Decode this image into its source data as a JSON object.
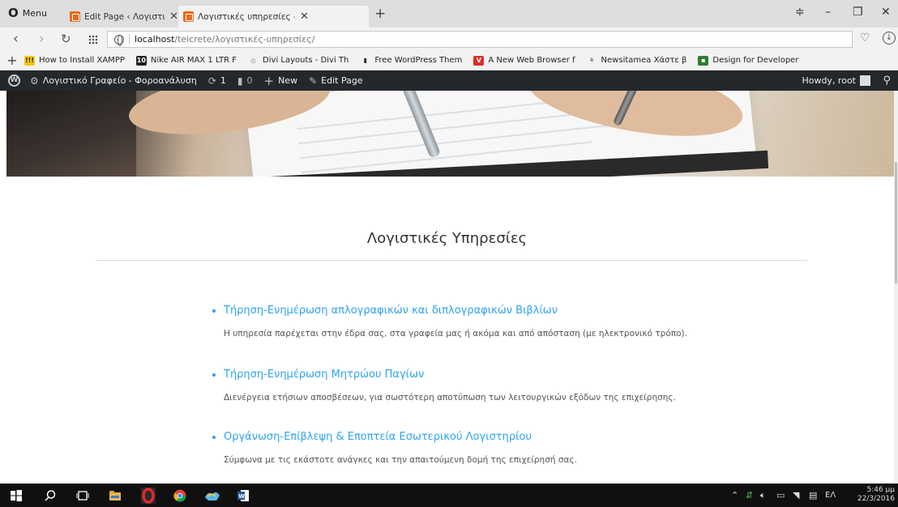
{
  "browser": {
    "menu_label": "Menu",
    "tabs": [
      {
        "title": "Edit Page ‹ Λογιστικό Γρα",
        "close": "✕"
      },
      {
        "title": "Λογιστικές υπηρεσίες – Λο",
        "close": "✕"
      }
    ],
    "new_tab": "+",
    "url_host": "localhost",
    "url_path": "/teicrete/λογιστικές-υπηρεσίες/"
  },
  "bookmarks": [
    {
      "label": "How to Install XAMPP",
      "icon_text": "!!!",
      "color": "#f2c811"
    },
    {
      "label": "Nike AIR MAX 1 LTR F",
      "icon_text": "10",
      "color": "#222222"
    },
    {
      "label": "Divi Layouts - Divi Th",
      "icon_text": "◎",
      "color": "#9a9a9a"
    },
    {
      "label": "Free WordPress Them",
      "icon_text": "▮",
      "color": "#333333"
    },
    {
      "label": "A New Web Browser f",
      "icon_text": "V",
      "color": "#d93025"
    },
    {
      "label": "Newsitamea Χάστε β",
      "icon_text": "⚘",
      "color": "#555555"
    },
    {
      "label": "Design for Developer",
      "icon_text": "▪",
      "color": "#2e7d32"
    }
  ],
  "adminbar": {
    "site_name": "Λογιστικό Γραφείο - Φοροανάλυση",
    "updates": "1",
    "comments": "0",
    "new_label": "New",
    "edit_label": "Edit Page",
    "howdy": "Howdy, root"
  },
  "page": {
    "title": "Λογιστικές Υπηρεσίες",
    "services": [
      {
        "heading": "Τήρηση-Ενημέρωση απλογραφικών και διπλογραφικών Βιβλίων",
        "description": "Η υπηρεσία παρέχεται στην έδρα σας, στα γραφεία μας ή ακόμα και από απόσταση (με ηλεκτρονικό τρόπο)."
      },
      {
        "heading": "Τήρηση-Ενημέρωση Μητρώου Παγίων",
        "description": "Διενέργεια ετήσιων αποσβέσεων, για σωστότερη αποτύπωση των λειτουργικών εξόδων της επιχείρησης."
      },
      {
        "heading": "Οργάνωση-Επίβλεψη & Εποπτεία Εσωτερικού Λογιστηρίου",
        "description": "Σύμφωνα με τις εκάστοτε ανάγκες και την απαιτούμενη δομή της επιχείρησή σας."
      }
    ]
  },
  "taskbar": {
    "language": "ΕΛ",
    "time": "5:46 μμ",
    "date": "22/3/2016"
  },
  "colors": {
    "link_blue": "#2ea3f2",
    "adminbar_bg": "#23282d",
    "tab_favicon": "#e86a1b"
  }
}
